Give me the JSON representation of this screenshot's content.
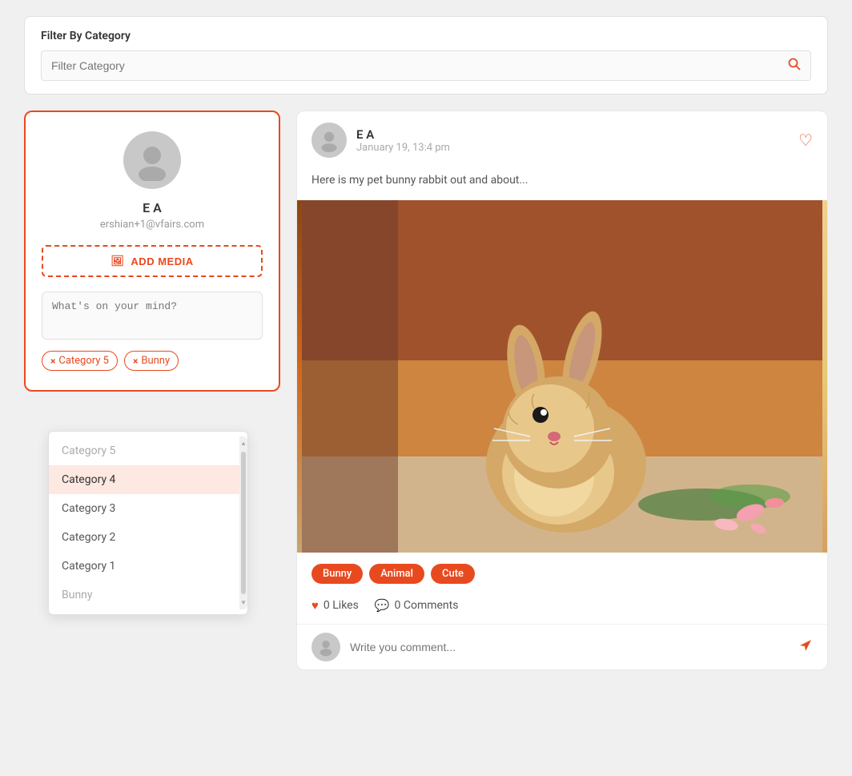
{
  "filterBar": {
    "title": "Filter By Category",
    "placeholder": "Filter Category"
  },
  "profile": {
    "name": "E A",
    "email": "ershian+1@vfairs.com",
    "addMediaLabel": "ADD MEDIA",
    "mindPlaceholder": "What's on your mind?",
    "selectedTags": [
      {
        "label": "Category 5"
      },
      {
        "label": "Bunny"
      }
    ]
  },
  "dropdown": {
    "items": [
      {
        "label": "Category 5",
        "type": "grayed"
      },
      {
        "label": "Category 4",
        "type": "selected"
      },
      {
        "label": "Category 3",
        "type": "normal"
      },
      {
        "label": "Category 2",
        "type": "normal"
      },
      {
        "label": "Category 1",
        "type": "normal"
      },
      {
        "label": "Bunny",
        "type": "grayed"
      }
    ]
  },
  "post": {
    "author": "E A",
    "date": "January 19, 13:4 pm",
    "text": "Here is my pet bunny rabbit out and about...",
    "tags": [
      "Bunny",
      "Animal",
      "Cute"
    ],
    "likes": "0 Likes",
    "comments": "0 Comments",
    "commentPlaceholder": "Write you comment..."
  },
  "icons": {
    "search": "🔍",
    "media": "🖼",
    "heart": "♡",
    "heartFilled": "♥",
    "comment": "💬",
    "send": "➤"
  }
}
